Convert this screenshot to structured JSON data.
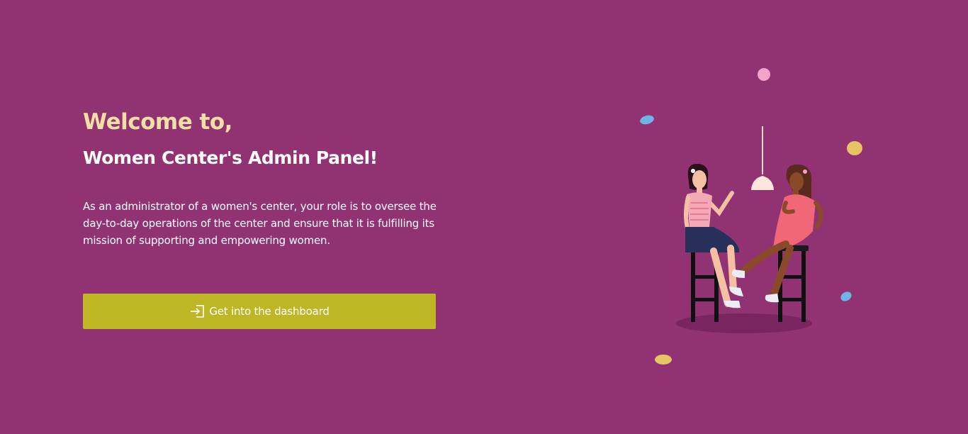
{
  "hero": {
    "welcome": "Welcome to,",
    "title": "Women Center's Admin Panel!",
    "description": "As an administrator of a women's center, your role is to oversee the day-to-day operations of the center and ensure that it is fulfilling its mission of supporting and empowering women."
  },
  "cta": {
    "label": "Get into the dashboard",
    "icon": "login-icon"
  },
  "colors": {
    "background": "#913373",
    "welcome_text": "#f1dfa6",
    "button": "#bdb726"
  },
  "illustration": {
    "name": "two-women-talking-illustration"
  }
}
